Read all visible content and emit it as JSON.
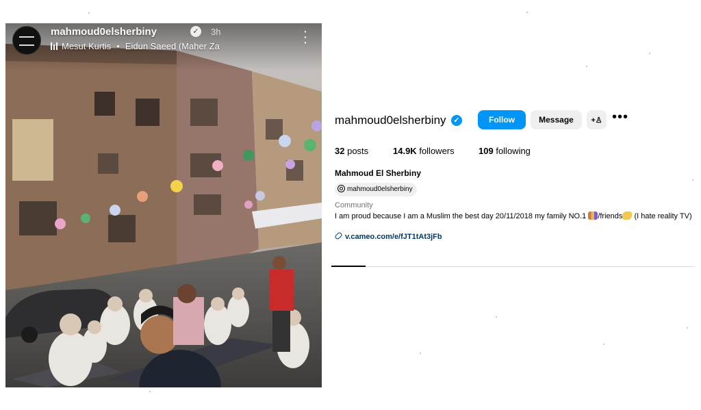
{
  "story": {
    "username": "mahmoud0elsherbiny",
    "time": "3h",
    "music_artist": "Mesut Kurtis",
    "music_title": "Eidun Saeed (Maher Za"
  },
  "profile": {
    "username": "mahmoud0elsherbiny",
    "follow_label": "Follow",
    "message_label": "Message",
    "add_person_label": "+♙",
    "more_label": "•••",
    "stats": {
      "posts_count": "32",
      "posts_label": "posts",
      "followers_count": "14.9K",
      "followers_label": "followers",
      "following_count": "109",
      "following_label": "following"
    },
    "full_name": "Mahmoud El Sherbiny",
    "threads_handle": "mahmoud0elsherbiny",
    "category": "Community",
    "bio_part1": "I am proud because I am a Muslim the best day 20/11/2018 my family NO.1 ",
    "bio_part2": "/friends",
    "bio_part3": " (I hate reality TV)",
    "link": "v.cameo.com/e/fJT1tAt3jFb"
  },
  "colors": {
    "accent": "#0095f6",
    "link": "#00376b",
    "secondary_text": "#737373",
    "button_bg": "#efefef"
  }
}
